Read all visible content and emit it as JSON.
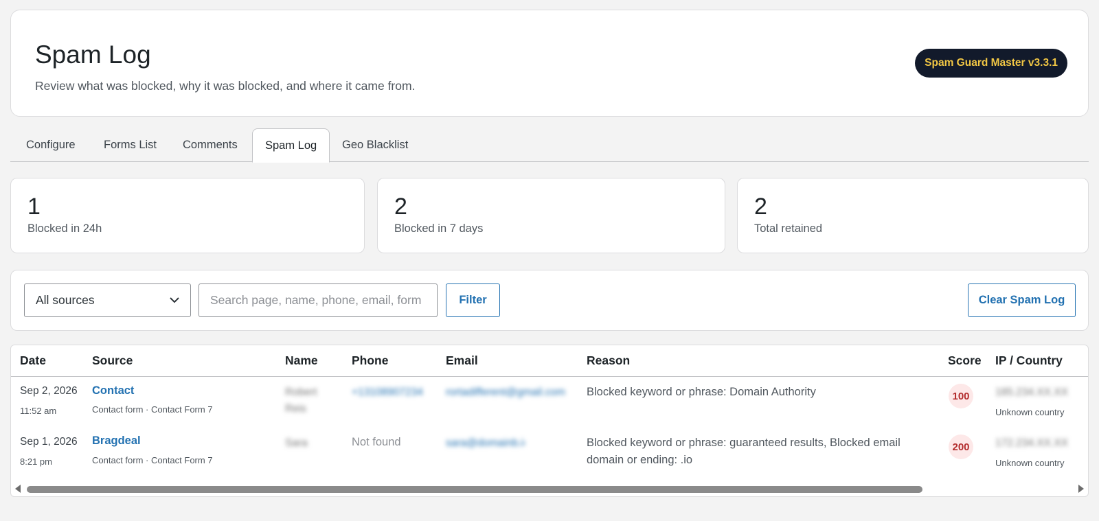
{
  "header": {
    "title": "Spam Log",
    "subtitle": "Review what was blocked, why it was blocked, and where it came from.",
    "version_badge": "Spam Guard Master v3.3.1"
  },
  "tabs": [
    {
      "label": "Configure",
      "active": false
    },
    {
      "label": "Forms List",
      "active": false
    },
    {
      "label": "Comments",
      "active": false
    },
    {
      "label": "Spam Log",
      "active": true
    },
    {
      "label": "Geo Blacklist",
      "active": false
    }
  ],
  "stats": [
    {
      "value": "1",
      "label": "Blocked in 24h"
    },
    {
      "value": "2",
      "label": "Blocked in 7 days"
    },
    {
      "value": "2",
      "label": "Total retained"
    }
  ],
  "filters": {
    "source_selected": "All sources",
    "search_placeholder": "Search page, name, phone, email, form",
    "filter_button": "Filter",
    "clear_button": "Clear Spam Log"
  },
  "table": {
    "columns": [
      "Date",
      "Source",
      "Name",
      "Phone",
      "Email",
      "Reason",
      "Score",
      "IP / Country"
    ],
    "rows": [
      {
        "date": "Sep 2, 2026",
        "time": "11:52 am",
        "source": "Contact",
        "source_meta": "Contact form · Contact Form 7",
        "name_line1": "Robert",
        "name_line2": "Reis",
        "phone": "+13108907234",
        "email": "rortadifferent@gmail.com",
        "reason": "Blocked keyword or phrase: Domain Authority",
        "score": "100",
        "ip": "185.234.XX.XX",
        "country": "Unknown country"
      },
      {
        "date": "Sep 1, 2026",
        "time": "8:21 pm",
        "source": "Bragdeal",
        "source_meta": "Contact form · Contact Form 7",
        "name_line1": "Sara",
        "name_line2": "",
        "phone": "Not found",
        "email": "sara@domainb.io",
        "reason": "Blocked keyword or phrase: guaranteed results, Blocked email domain or ending: .io",
        "score": "200",
        "ip": "172.234.XX.XX",
        "country": "Unknown country"
      }
    ]
  },
  "colors": {
    "accent": "#2271b1",
    "badge_bg": "#121a2b",
    "badge_text": "#f2c744",
    "score_bg": "#fde8e8",
    "score_text": "#b32d2e"
  }
}
